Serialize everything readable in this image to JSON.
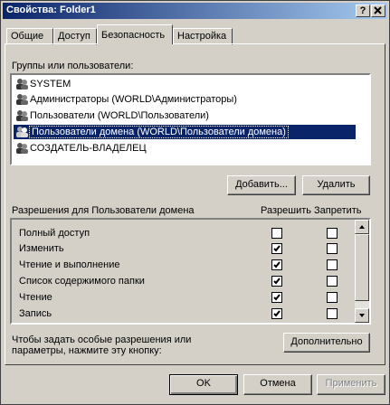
{
  "window": {
    "title": "Свойства: Folder1",
    "help_button": "?",
    "close_button": "X"
  },
  "tabs": [
    {
      "label": "Общие"
    },
    {
      "label": "Доступ"
    },
    {
      "label": "Безопасность",
      "active": true
    },
    {
      "label": "Настройка"
    }
  ],
  "groups_label": "Группы или пользователи:",
  "users": [
    {
      "name": "SYSTEM"
    },
    {
      "name": "Администраторы (WORLD\\Администраторы)"
    },
    {
      "name": "Пользователи (WORLD\\Пользователи)"
    },
    {
      "name": "Пользователи домена (WORLD\\Пользователи домена)",
      "selected": true
    },
    {
      "name": "СОЗДАТЕЛЬ-ВЛАДЕЛЕЦ"
    }
  ],
  "buttons": {
    "add": "Добавить...",
    "remove": "Удалить",
    "advanced": "Дополнительно",
    "ok": "OK",
    "cancel": "Отмена",
    "apply": "Применить"
  },
  "permissions": {
    "header": "Разрешения для Пользователи домена",
    "allow_header": "Разрешить",
    "deny_header": "Запретить",
    "rows": [
      {
        "name": "Полный доступ",
        "allow": false,
        "deny": false
      },
      {
        "name": "Изменить",
        "allow": true,
        "deny": false
      },
      {
        "name": "Чтение и выполнение",
        "allow": true,
        "deny": false
      },
      {
        "name": "Список содержимого папки",
        "allow": true,
        "deny": false
      },
      {
        "name": "Чтение",
        "allow": true,
        "deny": false
      },
      {
        "name": "Запись",
        "allow": true,
        "deny": false
      }
    ]
  },
  "special_text_line1": "Чтобы задать особые разрешения или",
  "special_text_line2": "параметры, нажмите эту кнопку:",
  "colors": {
    "title_start": "#0a246a",
    "title_end": "#a6caf0",
    "selection": "#0a246a",
    "face": "#d4d0c8"
  }
}
